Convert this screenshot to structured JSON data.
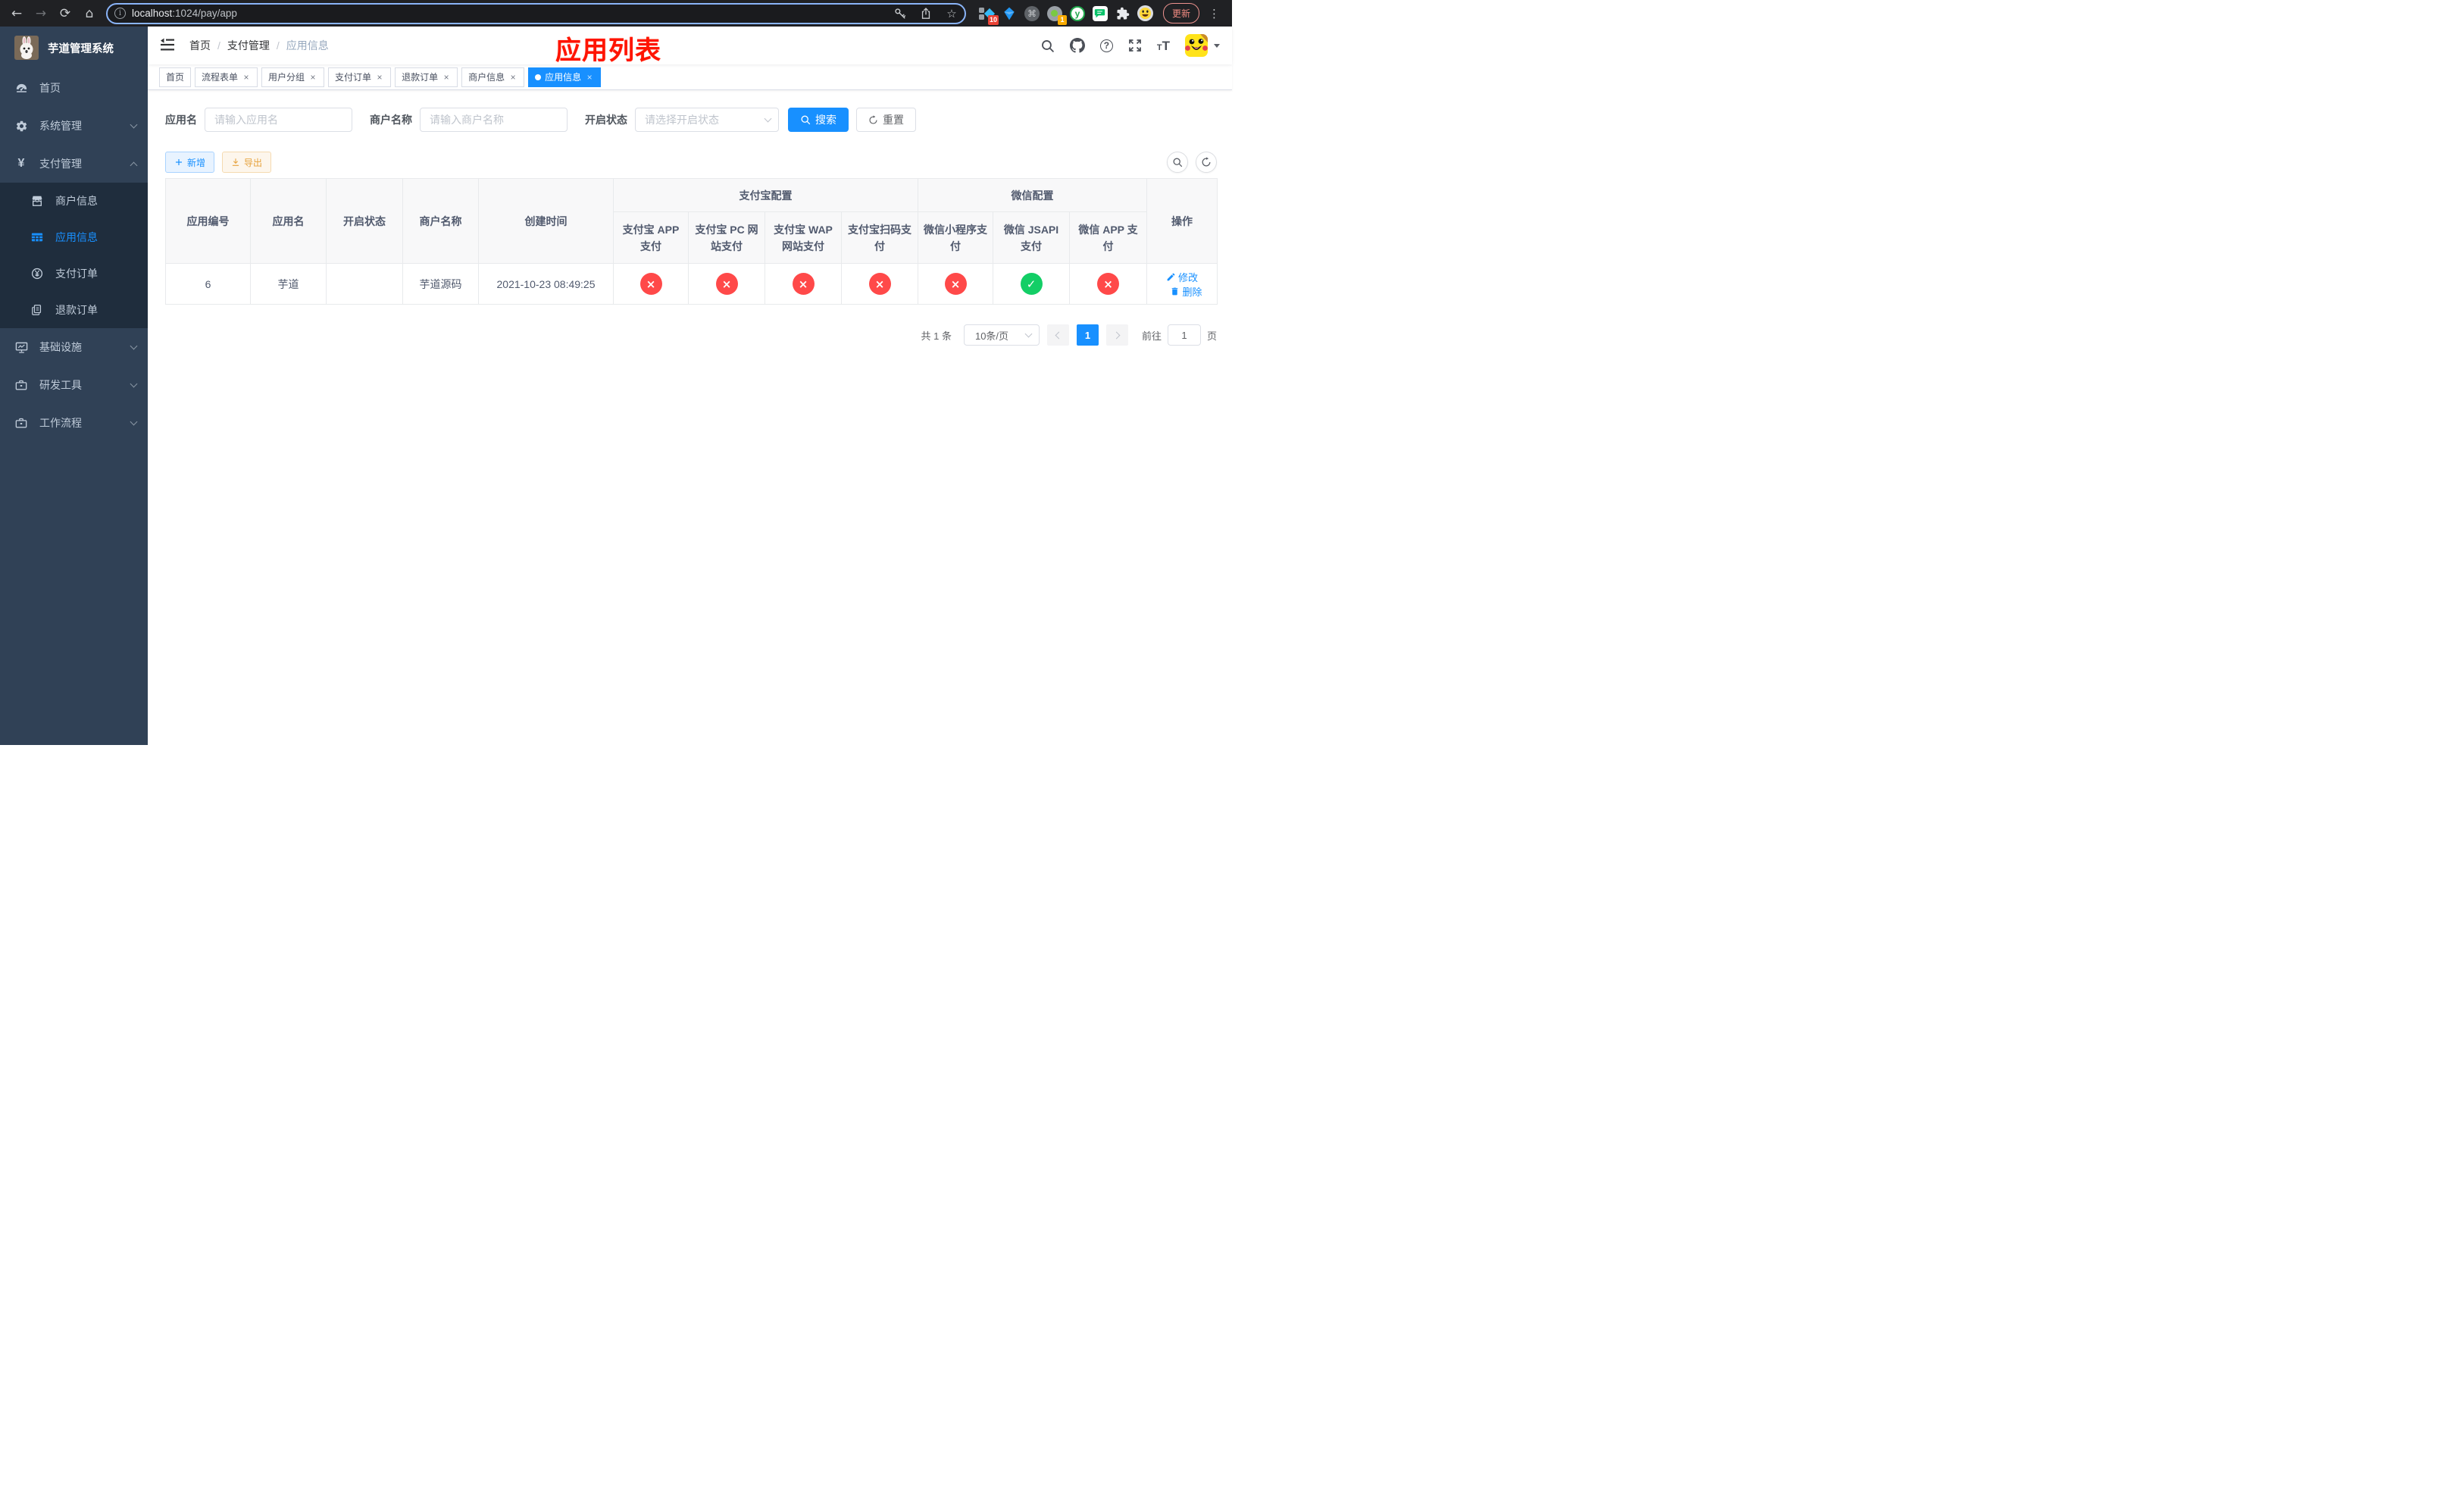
{
  "browser": {
    "url_host": "localhost",
    "url_path": ":1024/pay/app",
    "ext_badge_blue": "10",
    "ext_badge_orange": "1",
    "ext_cmd_glyph": "⌘",
    "ext_y_glyph": "y",
    "update_label": "更新",
    "menu_dots": "⋮"
  },
  "sidebar": {
    "title": "芋道管理系统",
    "home": "首页",
    "system": "系统管理",
    "payment": "支付管理",
    "payment_children": [
      "商户信息",
      "应用信息",
      "支付订单",
      "退款订单"
    ],
    "infra": "基础设施",
    "dev_tools": "研发工具",
    "workflow": "工作流程"
  },
  "navbar": {
    "breadcrumb": [
      "首页",
      "支付管理",
      "应用信息"
    ],
    "annotation": "应用列表"
  },
  "tabs": {
    "items": [
      {
        "label": "首页"
      },
      {
        "label": "流程表单"
      },
      {
        "label": "用户分组"
      },
      {
        "label": "支付订单"
      },
      {
        "label": "退款订单"
      },
      {
        "label": "商户信息"
      },
      {
        "label": "应用信息"
      }
    ]
  },
  "filters": {
    "app_name_label": "应用名",
    "app_name_placeholder": "请输入应用名",
    "merchant_label": "商户名称",
    "merchant_placeholder": "请输入商户名称",
    "status_label": "开启状态",
    "status_placeholder": "请选择开启状态",
    "search_label": "搜索",
    "reset_label": "重置"
  },
  "toolbar": {
    "add_label": "新增",
    "export_label": "导出"
  },
  "table": {
    "groups": {
      "alipay": "支付宝配置",
      "wechat": "微信配置"
    },
    "columns": {
      "app_id": "应用编号",
      "app_name": "应用名",
      "status": "开启状态",
      "merchant": "商户名称",
      "created": "创建时间",
      "alipay_app": "支付宝 APP 支付",
      "alipay_pc": "支付宝 PC 网站支付",
      "alipay_wap": "支付宝 WAP 网站支付",
      "alipay_qr": "支付宝扫码支付",
      "wx_lite": "微信小程序支付",
      "wx_jsapi": "微信 JSAPI 支付",
      "wx_app": "微信 APP 支付",
      "actions": "操作"
    },
    "row": {
      "app_id": "6",
      "app_name": "芋道",
      "enabled": true,
      "merchant": "芋道源码",
      "created": "2021-10-23 08:49:25",
      "statuses": [
        false,
        false,
        false,
        false,
        false,
        true,
        false
      ],
      "edit_label": "修改",
      "delete_label": "删除"
    }
  },
  "pagination": {
    "total": "共 1 条",
    "page_size": "10条/页",
    "page": "1",
    "goto_label": "前往",
    "goto_value": "1",
    "page_unit": "页"
  },
  "colors": {
    "accent": "#1890ff",
    "success": "#13ce66",
    "danger": "#ff4949",
    "warning": "#e6a23c",
    "sidebar_bg": "#304156",
    "submenu_bg": "#1f2d3d",
    "annotation_red": "#ff1400"
  }
}
